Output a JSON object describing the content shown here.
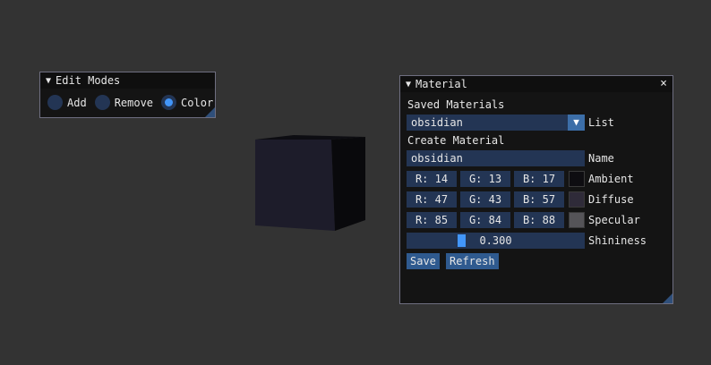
{
  "edit_modes": {
    "title": "Edit Modes",
    "options": [
      {
        "label": "Add",
        "selected": false
      },
      {
        "label": "Remove",
        "selected": false
      },
      {
        "label": "Color",
        "selected": true
      }
    ]
  },
  "material": {
    "title": "Material",
    "close": "×",
    "saved_label": "Saved Materials",
    "saved_value": "obsidian",
    "list_label": "List",
    "create_label": "Create Material",
    "name_value": "obsidian",
    "name_label": "Name",
    "ambient": {
      "r": "R: 14",
      "g": "G: 13",
      "b": "B: 17",
      "label": "Ambient",
      "color": "#0e0d11"
    },
    "diffuse": {
      "r": "R: 47",
      "g": "G: 43",
      "b": "B: 57",
      "label": "Diffuse",
      "color": "#2f2b39"
    },
    "specular": {
      "r": "R: 85",
      "g": "G: 84",
      "b": "B: 88",
      "label": "Specular",
      "color": "#555458"
    },
    "shininess_value": "0.300",
    "shininess_label": "Shininess",
    "save_label": "Save",
    "refresh_label": "Refresh"
  },
  "colors": {
    "accent": "#4296fa",
    "frame": "#233554",
    "button": "#2f5a8f"
  }
}
